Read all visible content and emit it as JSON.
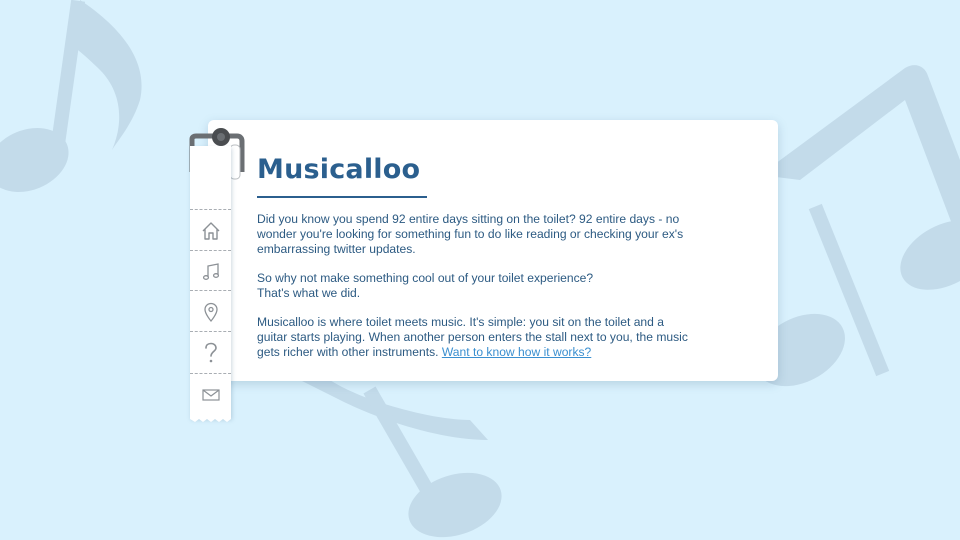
{
  "app": {
    "title": "Musicalloo"
  },
  "nav": {
    "items": [
      {
        "name": "home",
        "icon": "home-icon"
      },
      {
        "name": "music",
        "icon": "music-note-icon"
      },
      {
        "name": "location",
        "icon": "location-pin-icon"
      },
      {
        "name": "help",
        "icon": "question-mark-icon"
      },
      {
        "name": "contact",
        "icon": "envelope-icon"
      }
    ]
  },
  "content": {
    "p1": [
      "Did you know you spend 92 entire days sitting on the toilet? 92 entire days - no",
      "wonder you're looking for something fun to do like reading or checking your ex's",
      "embarrassing twitter updates."
    ],
    "p2": [
      "So why not make something cool out of your toilet experience?",
      "That's what we did."
    ],
    "p3": [
      "Musicalloo is where toilet meets music. It's simple: you sit on the toilet and a",
      "guitar starts playing. When another person enters the stall next to you, the music",
      "gets richer with other instruments. "
    ],
    "link": "Want to know how it works?"
  },
  "colors": {
    "background": "#d9f1fd",
    "notes": "#c3dbea",
    "title": "#2b5f8e",
    "text": "#2c5a82",
    "link": "#3a8fd0",
    "icons": "#8c9196"
  }
}
